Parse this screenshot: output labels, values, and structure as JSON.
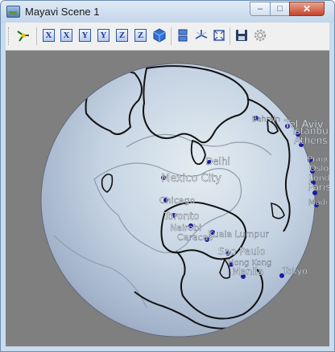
{
  "window": {
    "title": "Mayavi Scene 1"
  },
  "controls": {
    "minimize": "‒",
    "maximize": "□",
    "close": "✕"
  },
  "toolbar": {
    "axis_buttons": [
      "X",
      "X",
      "Y",
      "Y",
      "Z",
      "Z"
    ]
  },
  "scene": {
    "cities": [
      {
        "name": "Bahrain"
      },
      {
        "name": "Tel Aviv"
      },
      {
        "name": "Istanbul"
      },
      {
        "name": "Athens"
      },
      {
        "name": "Delhi"
      },
      {
        "name": "Mexico City"
      },
      {
        "name": "Chicago"
      },
      {
        "name": "Toronto"
      },
      {
        "name": "Nairobi"
      },
      {
        "name": "Caracas"
      },
      {
        "name": "Kuala Lumpur"
      },
      {
        "name": "Sao Paulo"
      },
      {
        "name": "Hong Kong"
      },
      {
        "name": "Manila"
      },
      {
        "name": "Tokyo"
      },
      {
        "name": "Prague"
      },
      {
        "name": "Oslo"
      },
      {
        "name": "London"
      },
      {
        "name": "Paris"
      },
      {
        "name": "Madrid"
      }
    ]
  },
  "colors": {
    "background": "#7f7f7f",
    "globe": "#c8d6e6",
    "markers": "#1a1aa0",
    "labels": "#ffffff"
  }
}
